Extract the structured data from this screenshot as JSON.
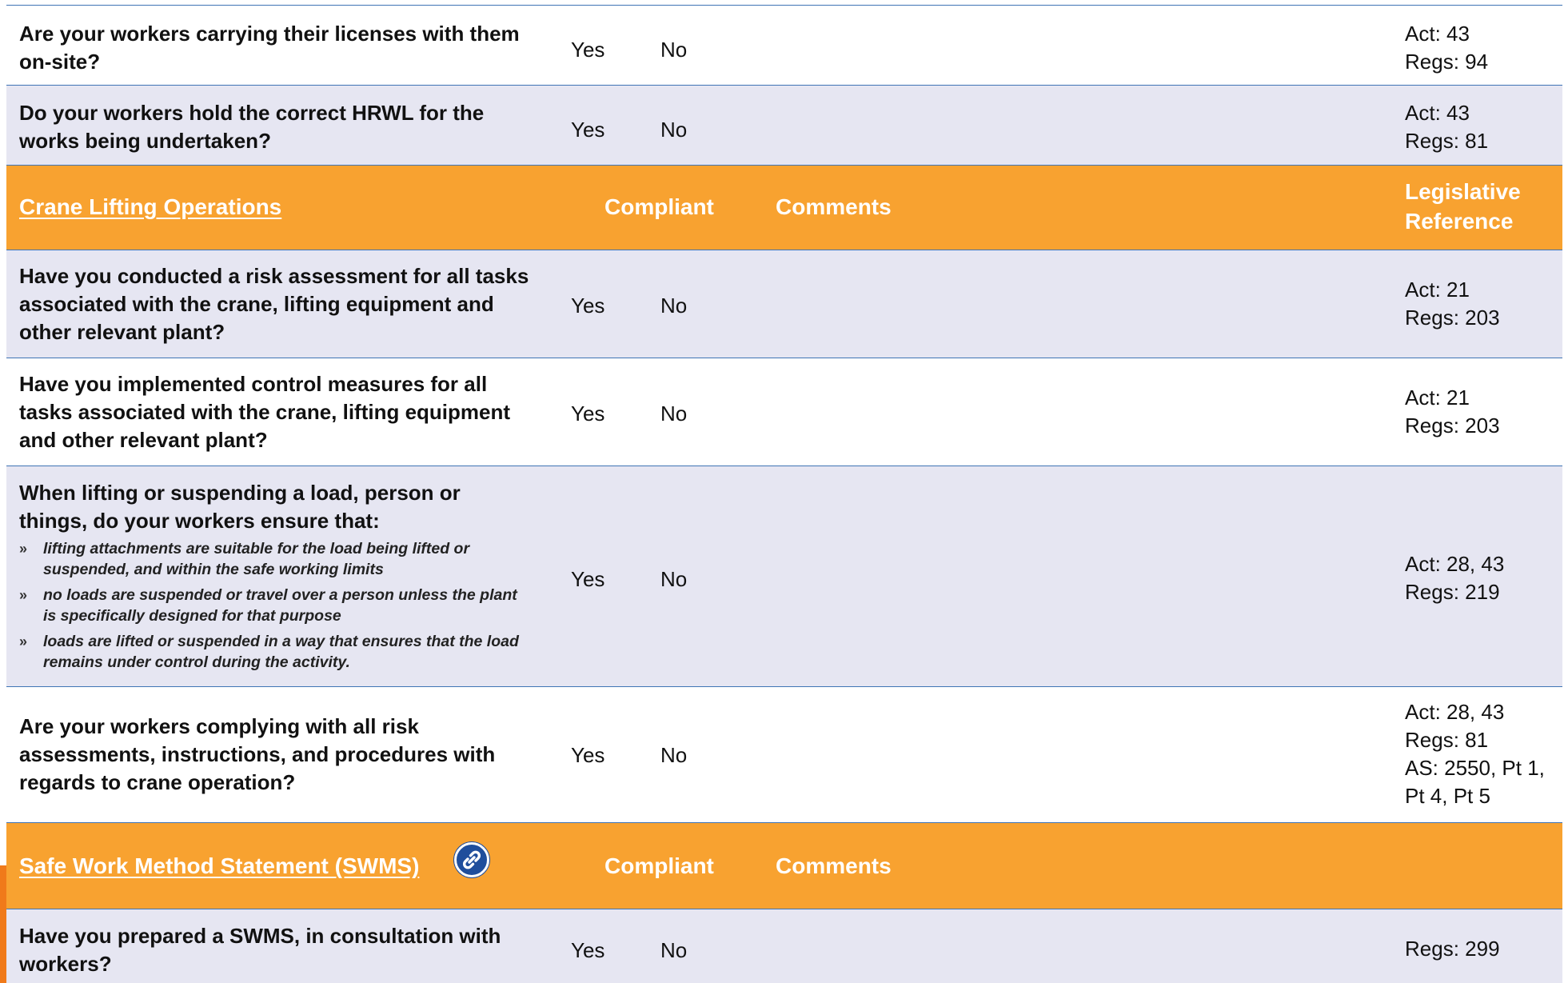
{
  "options": {
    "yes": "Yes",
    "no": "No"
  },
  "rows": [
    {
      "question": "Are your workers carrying their licenses with them on-site?",
      "reference": [
        "Act: 43",
        "Regs: 94"
      ]
    },
    {
      "question": "Do your workers hold the correct HRWL for the works being undertaken?",
      "reference": [
        "Act: 43",
        "Regs: 81"
      ]
    }
  ],
  "crane_section": {
    "title": "Crane Lifting Operations",
    "compliant_label": "Compliant",
    "comments_label": "Comments",
    "legislative_label": [
      "Legislative",
      "Reference"
    ],
    "rows": [
      {
        "question": "Have you conducted a risk assessment for all tasks associated with the crane, lifting equipment and other relevant plant?",
        "reference": [
          "Act: 21",
          "Regs: 203"
        ]
      },
      {
        "question": "Have you implemented control measures for all tasks associated with the crane, lifting equipment and other relevant plant?",
        "reference": [
          "Act: 21",
          "Regs: 203"
        ]
      },
      {
        "question": "When lifting or suspending a load, person or things, do your workers ensure that:",
        "bullet_marker": "»",
        "bullets": [
          "lifting attachments are suitable for the load being lifted or suspended, and within the safe working limits",
          "no loads are suspended or travel over a person unless the plant is specifically designed for that purpose",
          "loads are lifted or suspended in a way that ensures that the load remains under control during the activity."
        ],
        "reference": [
          "Act: 28, 43",
          "Regs: 219"
        ]
      },
      {
        "question": "Are your workers complying with all risk assessments, instructions, and procedures with regards to crane operation?",
        "reference": [
          "Act: 28, 43",
          "Regs: 81",
          "AS: 2550, Pt 1,",
          "Pt 4, Pt 5"
        ]
      }
    ]
  },
  "swms_section": {
    "title": "Safe Work Method Statement (SWMS)",
    "compliant_label": "Compliant",
    "comments_label": "Comments",
    "icon": "link-icon",
    "rows": [
      {
        "question": "Have you prepared a SWMS, in consultation with workers?",
        "reference": [
          "Regs: 299"
        ]
      }
    ]
  },
  "colors": {
    "header_orange": "#f8a230",
    "row_grey": "#e6e6f2",
    "rule_blue": "#3f74b5",
    "icon_blue": "#1f4e9c"
  }
}
